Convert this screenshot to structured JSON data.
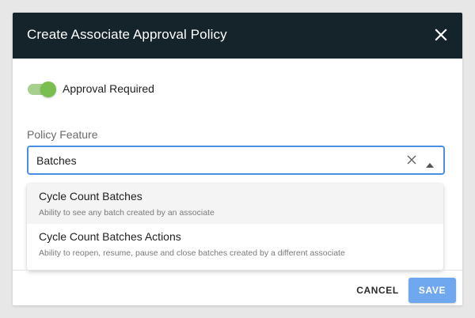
{
  "dialog": {
    "title": "Create Associate Approval Policy",
    "header_color": "#15232b"
  },
  "toggle": {
    "label": "Approval Required",
    "checked": true,
    "accent_color": "#79be4e"
  },
  "policy_feature": {
    "label": "Policy Feature",
    "value": "Batches",
    "focus_color": "#4a90e2"
  },
  "options": [
    {
      "title": "Cycle Count Batches",
      "description": "Ability to see any batch created by an associate",
      "highlighted": true
    },
    {
      "title": "Cycle Count Batches Actions",
      "description": "Ability to reopen, resume, pause and close batches created by a different associate",
      "highlighted": false
    }
  ],
  "footer": {
    "cancel_label": "CANCEL",
    "save_label": "SAVE",
    "save_color": "#6fa8ef"
  },
  "icons": {
    "close": "close-icon",
    "clear": "clear-icon",
    "dropdown_arrow": "arrow-up-icon"
  }
}
